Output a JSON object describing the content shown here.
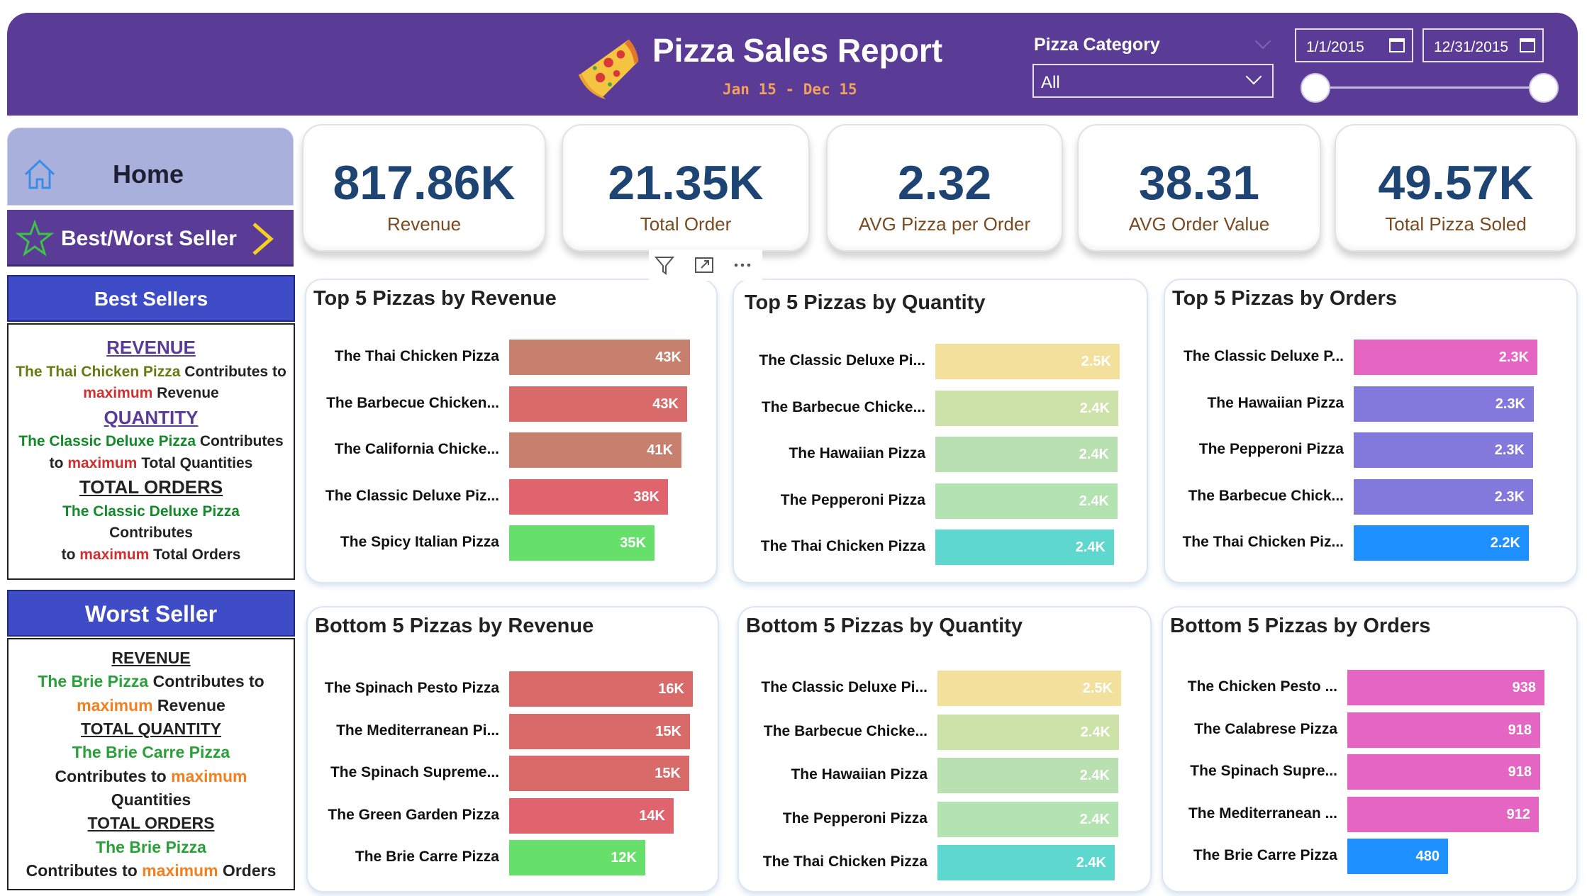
{
  "header": {
    "title": "Pizza Sales Report",
    "subtitle": "Jan 15 - Dec 15",
    "category_label": "Pizza Category",
    "category_value": "All",
    "date_start": "1/1/2015",
    "date_end": "12/31/2015",
    "date_range_slider": {
      "start": 0,
      "end": 1
    }
  },
  "nav": {
    "home_label": "Home",
    "bw_label": "Best/Worst Seller"
  },
  "best_sellers": {
    "heading": "Best Sellers",
    "revenue_title": "REVENUE",
    "revenue_pizza": "The Thai Chicken Pizza",
    "revenue_contrib": " Contributes to",
    "revenue_max": "maximum",
    "revenue_word": " Revenue",
    "quantity_title": "QUANTITY",
    "quantity_pizza": "The Classic Deluxe Pizza",
    "quantity_contrib": " Contributes",
    "quantity_to": "to ",
    "quantity_max": "maximum",
    "quantity_word": " Total Quantities",
    "orders_title": "TOTAL ORDERS",
    "orders_pizza": "The Classic Deluxe Pizza",
    "orders_contrib": "Contributes",
    "orders_to": "to ",
    "orders_max": "maximum",
    "orders_word": " Total Orders"
  },
  "worst_seller": {
    "heading": "Worst Seller",
    "revenue_title": "REVENUE",
    "revenue_pizza": "The Brie Pizza",
    "revenue_contrib": " Contributes to",
    "revenue_max": "maximum",
    "revenue_word": " Revenue",
    "quantity_title": "TOTAL QUANTITY",
    "quantity_pizza": "The Brie Carre Pizza",
    "quantity_contrib": "Contributes to ",
    "quantity_max": "maximum",
    "quantity_word": "Quantities",
    "orders_title": "TOTAL ORDERS",
    "orders_pizza": "The Brie Pizza",
    "orders_contrib": "Contributes to ",
    "orders_max": "maximum",
    "orders_word": " Orders"
  },
  "kpis": [
    {
      "value": "817.86K",
      "label": "Revenue"
    },
    {
      "value": "21.35K",
      "label": "Total Order"
    },
    {
      "value": "2.32",
      "label": "AVG Pizza per Order"
    },
    {
      "value": "38.31",
      "label": "AVG Order Value"
    },
    {
      "value": "49.57K",
      "label": "Total Pizza Soled"
    }
  ],
  "chart_data": [
    {
      "type": "bar",
      "title": "Top 5 Pizzas by Revenue",
      "categories": [
        "The Thai Chicken Pizza",
        "The Barbecue Chicken...",
        "The California Chicke...",
        "The Classic Deluxe Piz...",
        "The Spicy Italian Pizza"
      ],
      "values": [
        43434,
        42768,
        41410,
        38180,
        34832
      ],
      "labels": [
        "43K",
        "43K",
        "41K",
        "38K",
        "35K"
      ],
      "colors": [
        "#c8806e",
        "#d96a6a",
        "#c8806e",
        "#e0646e",
        "#66e06a"
      ],
      "xlim": [
        0,
        48000
      ]
    },
    {
      "type": "bar",
      "title": "Top 5 Pizzas by Quantity",
      "categories": [
        "The Classic Deluxe Pi...",
        "The Barbecue Chicke...",
        "The Hawaiian Pizza",
        "The Pepperoni Pizza",
        "The Thai Chicken Pizza"
      ],
      "values": [
        2453,
        2432,
        2422,
        2418,
        2371
      ],
      "labels": [
        "2.5K",
        "2.4K",
        "2.4K",
        "2.4K",
        "2.4K"
      ],
      "colors": [
        "#f3e09c",
        "#cde2a8",
        "#b8e0b0",
        "#b4e3b2",
        "#5ed8cf"
      ],
      "xlim": [
        0,
        2600
      ]
    },
    {
      "type": "bar",
      "title": "Top 5 Pizzas by Orders",
      "categories": [
        "The Classic Deluxe P...",
        "The Hawaiian Pizza",
        "The Pepperoni Pizza",
        "The Barbecue Chick...",
        "The Thai Chicken Piz..."
      ],
      "values": [
        2329,
        2280,
        2278,
        2273,
        2225
      ],
      "labels": [
        "2.3K",
        "2.3K",
        "2.3K",
        "2.3K",
        "2.2K"
      ],
      "colors": [
        "#e566c2",
        "#8378dc",
        "#8378dc",
        "#8378dc",
        "#1e90ff"
      ],
      "xlim": [
        0,
        2500
      ]
    },
    {
      "type": "bar",
      "title": "Bottom 5 Pizzas by Revenue",
      "categories": [
        "The Spinach Pesto Pizza",
        "The Mediterranean Pi...",
        "The Spinach Supreme...",
        "The Green Garden Pizza",
        "The Brie Carre Pizza"
      ],
      "values": [
        15596,
        15360,
        15278,
        13956,
        11588
      ],
      "labels": [
        "16K",
        "15K",
        "15K",
        "14K",
        "12K"
      ],
      "colors": [
        "#d96a6a",
        "#d96a6a",
        "#d96a6a",
        "#e0646e",
        "#66e06a"
      ],
      "xlim": [
        0,
        16500
      ]
    },
    {
      "type": "bar",
      "title": "Bottom 5 Pizzas by Quantity",
      "categories": [
        "The Classic Deluxe Pi...",
        "The Barbecue Chicke...",
        "The Hawaiian Pizza",
        "The Pepperoni Pizza",
        "The Thai Chicken Pizza"
      ],
      "values": [
        2453,
        2432,
        2422,
        2418,
        2371
      ],
      "labels": [
        "2.5K",
        "2.4K",
        "2.4K",
        "2.4K",
        "2.4K"
      ],
      "colors": [
        "#f3e09c",
        "#cde2a8",
        "#b8e0b0",
        "#b4e3b2",
        "#5ed8cf"
      ],
      "xlim": [
        0,
        2600
      ]
    },
    {
      "type": "bar",
      "title": "Bottom 5 Pizzas by Orders",
      "categories": [
        "The Chicken Pesto ...",
        "The Calabrese Pizza",
        "The Spinach Supre...",
        "The Mediterranean ...",
        "The Brie Carre Pizza"
      ],
      "values": [
        938,
        918,
        918,
        912,
        480
      ],
      "labels": [
        "938",
        "918",
        "918",
        "912",
        "480"
      ],
      "colors": [
        "#e566c2",
        "#e566c2",
        "#e566c2",
        "#e566c2",
        "#1e90ff"
      ],
      "xlim": [
        0,
        980
      ]
    }
  ]
}
